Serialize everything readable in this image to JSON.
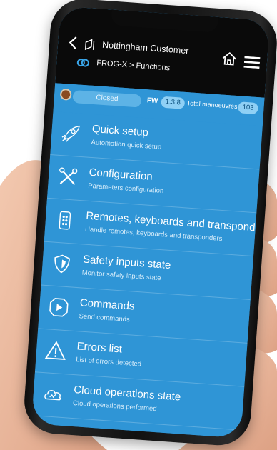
{
  "header": {
    "customer": "Nottingham Customer",
    "breadcrumb": "FROG-X > Functions"
  },
  "status": {
    "state": "Closed",
    "fw_label": "FW",
    "fw_version": "1.3.8",
    "manoeuvres_label": "Total manoeuvres",
    "manoeuvres_count": "103"
  },
  "menu": {
    "items": [
      {
        "title": "Quick setup",
        "subtitle": "Automation quick setup",
        "icon": "rocket-icon"
      },
      {
        "title": "Configuration",
        "subtitle": "Parameters configuration",
        "icon": "tools-icon"
      },
      {
        "title": "Remotes, keyboards and transponders",
        "subtitle": "Handle remotes, keyboards and transponders",
        "icon": "remote-icon"
      },
      {
        "title": "Safety inputs state",
        "subtitle": "Monitor safety inputs state",
        "icon": "shield-icon"
      },
      {
        "title": "Commands",
        "subtitle": "Send commands",
        "icon": "play-icon"
      },
      {
        "title": "Errors list",
        "subtitle": "List of errors detected",
        "icon": "warning-icon"
      },
      {
        "title": "Cloud operations state",
        "subtitle": "Cloud operations performed",
        "icon": "cloud-icon"
      }
    ]
  },
  "colors": {
    "screen_bg": "#2f95d6",
    "appbar_bg": "#0a0a0a",
    "badge_bg": "#8fd0f5",
    "status_led": "#8a4b22"
  }
}
